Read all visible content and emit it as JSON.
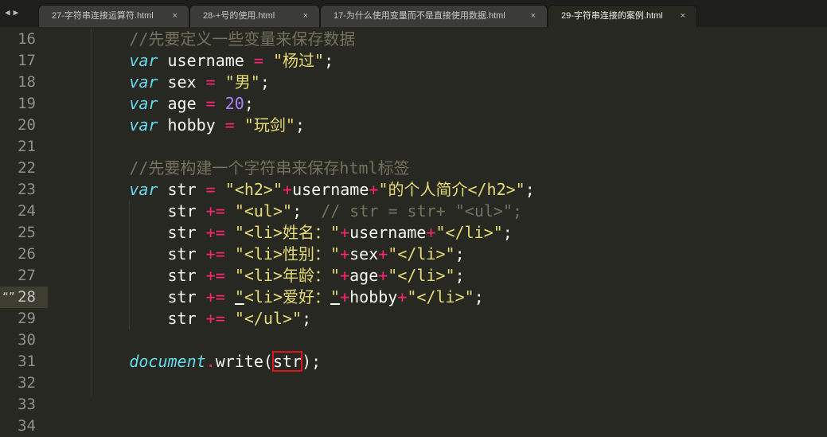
{
  "nav": {
    "back": "◀",
    "forward": "▶"
  },
  "tabs": [
    {
      "label": "27-字符串连接运算符.html",
      "close": "×"
    },
    {
      "label": "28-+号的使用.html",
      "close": "×"
    },
    {
      "label": "17-为什么使用变量而不是直接使用数据.html",
      "close": "×"
    },
    {
      "label": "29-字符串连接的案例.html",
      "close": "×",
      "active": true
    }
  ],
  "gutter_marker": "“”",
  "lines": [
    {
      "n": "16",
      "indent": "        ",
      "tokens": [
        {
          "t": "//先要定义一些变量来保存数据",
          "c": "cm"
        }
      ]
    },
    {
      "n": "17",
      "indent": "        ",
      "tokens": [
        {
          "t": "var",
          "c": "kw"
        },
        {
          "t": " username ",
          "c": ""
        },
        {
          "t": "=",
          "c": "op"
        },
        {
          "t": " ",
          "c": ""
        },
        {
          "t": "\"杨过\"",
          "c": "str"
        },
        {
          "t": ";",
          "c": ""
        }
      ]
    },
    {
      "n": "18",
      "indent": "        ",
      "tokens": [
        {
          "t": "var",
          "c": "kw"
        },
        {
          "t": " sex ",
          "c": ""
        },
        {
          "t": "=",
          "c": "op"
        },
        {
          "t": " ",
          "c": ""
        },
        {
          "t": "\"男\"",
          "c": "str"
        },
        {
          "t": ";",
          "c": ""
        }
      ]
    },
    {
      "n": "19",
      "indent": "        ",
      "tokens": [
        {
          "t": "var",
          "c": "kw"
        },
        {
          "t": " age ",
          "c": ""
        },
        {
          "t": "=",
          "c": "op"
        },
        {
          "t": " ",
          "c": ""
        },
        {
          "t": "20",
          "c": "num"
        },
        {
          "t": ";",
          "c": ""
        }
      ]
    },
    {
      "n": "20",
      "indent": "        ",
      "tokens": [
        {
          "t": "var",
          "c": "kw"
        },
        {
          "t": " hobby ",
          "c": ""
        },
        {
          "t": "=",
          "c": "op"
        },
        {
          "t": " ",
          "c": ""
        },
        {
          "t": "\"玩剑\"",
          "c": "str"
        },
        {
          "t": ";",
          "c": ""
        }
      ]
    },
    {
      "n": "21",
      "indent": "",
      "tokens": []
    },
    {
      "n": "22",
      "indent": "        ",
      "tokens": [
        {
          "t": "//先要构建一个字符串来保存html标签",
          "c": "cm"
        }
      ]
    },
    {
      "n": "23",
      "indent": "        ",
      "tokens": [
        {
          "t": "var",
          "c": "kw"
        },
        {
          "t": " str ",
          "c": ""
        },
        {
          "t": "=",
          "c": "op"
        },
        {
          "t": " ",
          "c": ""
        },
        {
          "t": "\"<h2>\"",
          "c": "str"
        },
        {
          "t": "+",
          "c": "op"
        },
        {
          "t": "username",
          "c": ""
        },
        {
          "t": "+",
          "c": "op"
        },
        {
          "t": "\"的个人简介</h2>\"",
          "c": "str"
        },
        {
          "t": ";",
          "c": ""
        }
      ]
    },
    {
      "n": "24",
      "indent": "            ",
      "tokens": [
        {
          "t": "str ",
          "c": ""
        },
        {
          "t": "+=",
          "c": "op"
        },
        {
          "t": " ",
          "c": ""
        },
        {
          "t": "\"<ul>\"",
          "c": "str"
        },
        {
          "t": ";  ",
          "c": ""
        },
        {
          "t": "// str = str+ \"<ul>\";",
          "c": "cm"
        }
      ]
    },
    {
      "n": "25",
      "indent": "            ",
      "tokens": [
        {
          "t": "str ",
          "c": ""
        },
        {
          "t": "+=",
          "c": "op"
        },
        {
          "t": " ",
          "c": ""
        },
        {
          "t": "\"<li>姓名：\"",
          "c": "str"
        },
        {
          "t": "+",
          "c": "op"
        },
        {
          "t": "username",
          "c": ""
        },
        {
          "t": "+",
          "c": "op"
        },
        {
          "t": "\"</li>\"",
          "c": "str"
        },
        {
          "t": ";",
          "c": ""
        }
      ]
    },
    {
      "n": "26",
      "indent": "            ",
      "tokens": [
        {
          "t": "str ",
          "c": ""
        },
        {
          "t": "+=",
          "c": "op"
        },
        {
          "t": " ",
          "c": ""
        },
        {
          "t": "\"<li>性别：\"",
          "c": "str"
        },
        {
          "t": "+",
          "c": "op"
        },
        {
          "t": "sex",
          "c": ""
        },
        {
          "t": "+",
          "c": "op"
        },
        {
          "t": "\"</li>\"",
          "c": "str"
        },
        {
          "t": ";",
          "c": ""
        }
      ]
    },
    {
      "n": "27",
      "indent": "            ",
      "tokens": [
        {
          "t": "str ",
          "c": ""
        },
        {
          "t": "+=",
          "c": "op"
        },
        {
          "t": " ",
          "c": ""
        },
        {
          "t": "\"<li>年龄：\"",
          "c": "str"
        },
        {
          "t": "+",
          "c": "op"
        },
        {
          "t": "age",
          "c": ""
        },
        {
          "t": "+",
          "c": "op"
        },
        {
          "t": "\"</li>\"",
          "c": "str"
        },
        {
          "t": ";",
          "c": ""
        }
      ]
    },
    {
      "n": "28",
      "indent": "            ",
      "current": true,
      "tokens": [
        {
          "t": "str ",
          "c": ""
        },
        {
          "t": "+=",
          "c": "op"
        },
        {
          "t": " ",
          "c": ""
        },
        {
          "t": "\"",
          "c": "str uline"
        },
        {
          "t": "<li>爱好：",
          "c": "str"
        },
        {
          "t": "\"",
          "c": "str uline"
        },
        {
          "t": "+",
          "c": "op"
        },
        {
          "t": "hobby",
          "c": ""
        },
        {
          "t": "+",
          "c": "op"
        },
        {
          "t": "\"</li>\"",
          "c": "str"
        },
        {
          "t": ";",
          "c": ""
        }
      ]
    },
    {
      "n": "29",
      "indent": "            ",
      "tokens": [
        {
          "t": "str ",
          "c": ""
        },
        {
          "t": "+=",
          "c": "op"
        },
        {
          "t": " ",
          "c": ""
        },
        {
          "t": "\"</ul>\"",
          "c": "str"
        },
        {
          "t": ";",
          "c": ""
        }
      ]
    },
    {
      "n": "30",
      "indent": "",
      "tokens": []
    },
    {
      "n": "31",
      "indent": "        ",
      "tokens": [
        {
          "t": "document",
          "c": "fn"
        },
        {
          "t": ".",
          "c": "op"
        },
        {
          "t": "write(",
          "c": ""
        },
        {
          "t": "str",
          "c": "hl-box"
        },
        {
          "t": ");",
          "c": ""
        }
      ]
    },
    {
      "n": "32",
      "indent": "",
      "tokens": []
    },
    {
      "n": "33",
      "indent": "",
      "tokens": []
    },
    {
      "n": "34",
      "indent": "",
      "tokens": []
    }
  ]
}
